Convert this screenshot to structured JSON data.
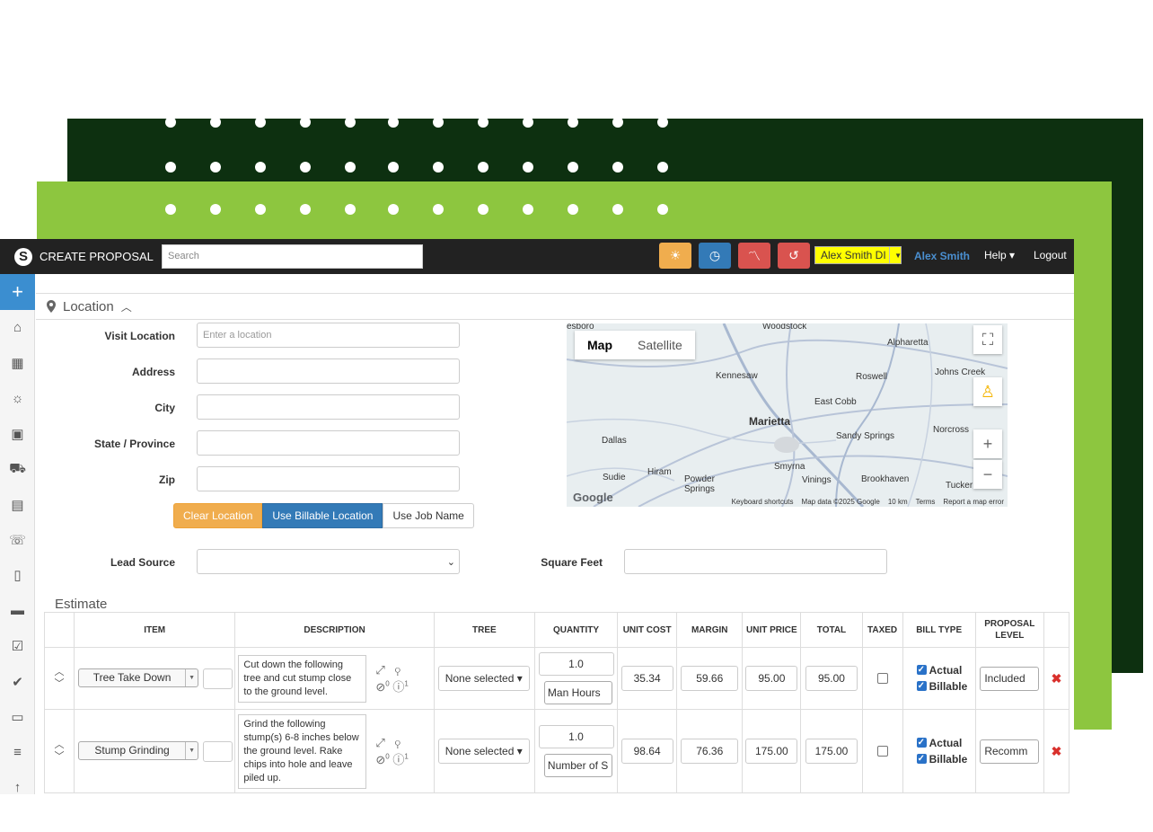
{
  "app": {
    "brand": "CREATE PROPOSAL",
    "search_placeholder": "Search",
    "user_select": "Alex Smith DI",
    "user_name": "Alex Smith",
    "help": "Help",
    "logout": "Logout",
    "colors": {
      "sun": "#f0ad4e",
      "clock": "#337ab7",
      "chart": "#d9534f",
      "history": "#d9534f",
      "accent": "#8dc63f",
      "dark": "#0d3010"
    }
  },
  "location": {
    "section_title": "Location",
    "fields": {
      "visit_location": {
        "label": "Visit Location",
        "placeholder": "Enter a location"
      },
      "address": {
        "label": "Address"
      },
      "city": {
        "label": "City"
      },
      "state": {
        "label": "State / Province"
      },
      "zip": {
        "label": "Zip"
      }
    },
    "buttons": {
      "clear": "Clear Location",
      "billable": "Use Billable Location",
      "job_name": "Use Job Name"
    },
    "lead_source_label": "Lead Source",
    "square_feet_label": "Square Feet"
  },
  "map": {
    "tab_map": "Map",
    "tab_satellite": "Satellite",
    "towns": [
      "Woodstock",
      "Alpharetta",
      "Kennesaw",
      "Roswell",
      "Johns Creek",
      "Marietta",
      "East Cobb",
      "Dallas",
      "Sandy Springs",
      "Norcross",
      "Hiram",
      "Powder Springs",
      "Smyrna",
      "Vinings",
      "Brookhaven",
      "Tucker",
      "Sudie",
      "esboro"
    ],
    "footer": {
      "shortcuts": "Keyboard shortcuts",
      "data": "Map data ©2025 Google",
      "scale": "10 km",
      "terms": "Terms",
      "report": "Report a map error"
    },
    "logo": "Google"
  },
  "estimate": {
    "title": "Estimate",
    "headers": [
      "ITEM",
      "DESCRIPTION",
      "TREE",
      "QUANTITY",
      "UNIT COST",
      "MARGIN",
      "UNIT PRICE",
      "TOTAL",
      "TAXED",
      "BILL TYPE",
      "PROPOSAL LEVEL"
    ],
    "rows": [
      {
        "item": "Tree Take Down",
        "description": "Cut down the following tree and cut stump close to the ground level.",
        "tree": "None selected",
        "quantity": "1.0",
        "unit": "Man Hours",
        "unit_cost": "35.34",
        "margin": "59.66",
        "unit_price": "95.00",
        "total": "95.00",
        "actual": "Actual",
        "billable": "Billable",
        "level": "Included",
        "attach_count": "0",
        "info_count": "1"
      },
      {
        "item": "Stump Grinding",
        "description": "Grind the following stump(s) 6-8 inches below the ground level. Rake chips into hole and leave piled up.",
        "tree": "None selected",
        "quantity": "1.0",
        "unit": "Number of S",
        "unit_cost": "98.64",
        "margin": "76.36",
        "unit_price": "175.00",
        "total": "175.00",
        "actual": "Actual",
        "billable": "Billable",
        "level": "Recomm",
        "attach_count": "0",
        "info_count": "1"
      }
    ]
  }
}
